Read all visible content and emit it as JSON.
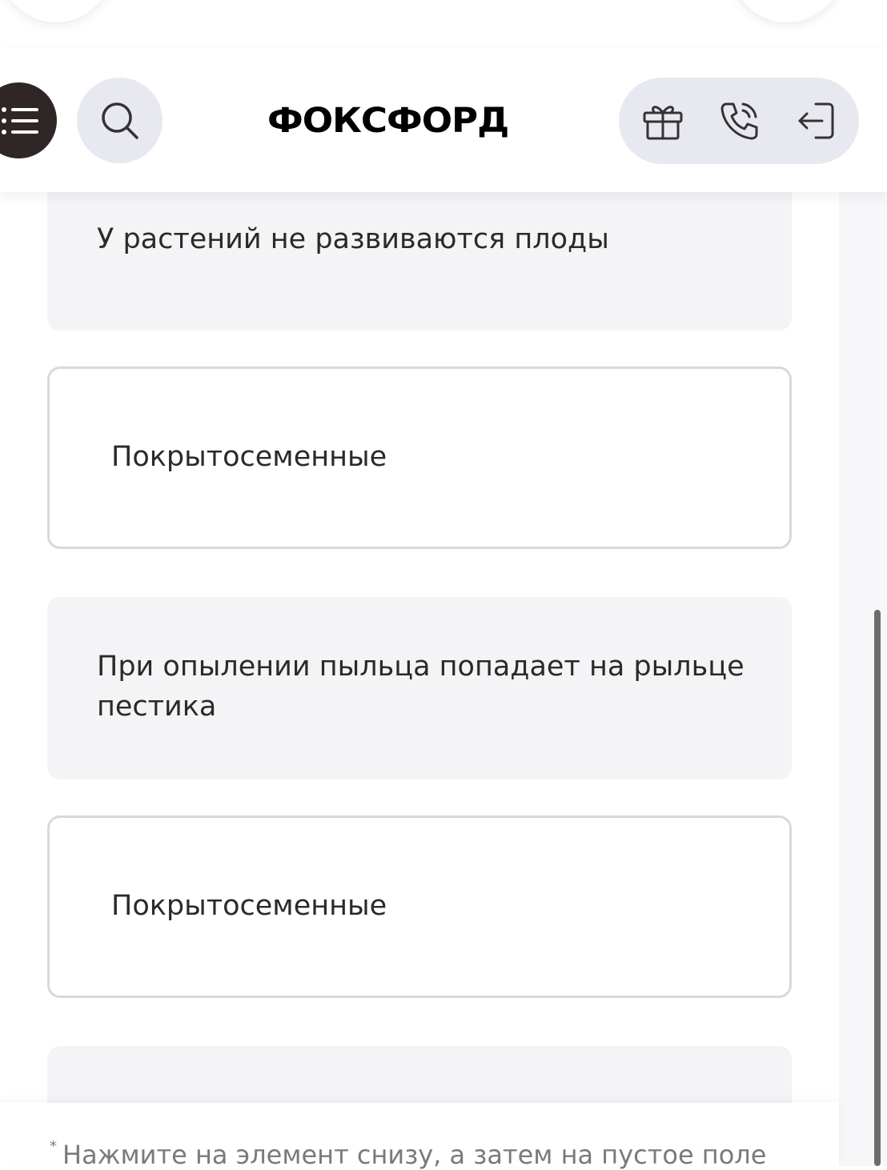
{
  "header": {
    "logo_text": "ФОКСФОРД",
    "icons": [
      "menu-icon",
      "search-icon",
      "gift-icon",
      "phone-icon",
      "login-icon"
    ]
  },
  "cards": [
    {
      "type": "statement",
      "text": "У растений не развиваются плоды"
    },
    {
      "type": "answer",
      "text": "Покрытосеменные"
    },
    {
      "type": "statement",
      "text": "При опылении пыльца попадает на рыльце пестика"
    },
    {
      "type": "answer",
      "text": "Покрытосеменные"
    },
    {
      "type": "statement",
      "text": ""
    }
  ],
  "footer": {
    "hint_marker": "*",
    "hint_text": "Нажмите на элемент снизу, а затем на пустое поле"
  },
  "colors": {
    "header_button_bg": "#e8e9f0",
    "menu_button_bg": "#2e2726",
    "statement_bg": "#f4f4f6",
    "answer_border": "#d9d9dc"
  }
}
